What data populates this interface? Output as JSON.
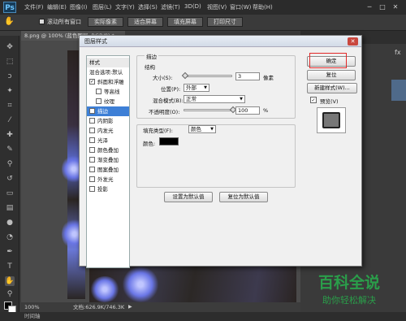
{
  "app": {
    "logo": "Ps"
  },
  "menu": [
    "文件(F)",
    "编辑(E)",
    "图像(I)",
    "图层(L)",
    "文字(Y)",
    "选择(S)",
    "滤镜(T)",
    "3D(D)",
    "视图(V)",
    "窗口(W)",
    "帮助(H)"
  ],
  "window_controls": {
    "minimize": "─",
    "restore": "□",
    "close": "✕"
  },
  "options_bar": {
    "scroll_all": "滚动所有窗口",
    "actual_pixels": "实际像素",
    "fit_screen": "适合屏幕",
    "fill_screen": "填充屏幕",
    "print_size": "打印尺寸"
  },
  "document": {
    "tab": "8.png @ 100% (蓝色图层, RGB/8) *",
    "zoom": "100%",
    "doc_info": "文档:626.9K/746.3K",
    "timeline": "时间轴"
  },
  "dialog": {
    "title": "图层样式",
    "close": "✕",
    "styles_header": "样式",
    "styles": [
      {
        "label": "混合选项:默认",
        "checkbox": false,
        "checked": false,
        "indent": false,
        "selected": false
      },
      {
        "label": "斜面和浮雕",
        "checkbox": true,
        "checked": true,
        "indent": false,
        "selected": false
      },
      {
        "label": "等高线",
        "checkbox": true,
        "checked": false,
        "indent": true,
        "selected": false
      },
      {
        "label": "纹理",
        "checkbox": true,
        "checked": false,
        "indent": true,
        "selected": false
      },
      {
        "label": "描边",
        "checkbox": true,
        "checked": true,
        "indent": false,
        "selected": true
      },
      {
        "label": "内阴影",
        "checkbox": true,
        "checked": false,
        "indent": false,
        "selected": false
      },
      {
        "label": "内发光",
        "checkbox": true,
        "checked": false,
        "indent": false,
        "selected": false
      },
      {
        "label": "光泽",
        "checkbox": true,
        "checked": false,
        "indent": false,
        "selected": false
      },
      {
        "label": "颜色叠加",
        "checkbox": true,
        "checked": false,
        "indent": false,
        "selected": false
      },
      {
        "label": "渐变叠加",
        "checkbox": true,
        "checked": false,
        "indent": false,
        "selected": false
      },
      {
        "label": "图案叠加",
        "checkbox": true,
        "checked": false,
        "indent": false,
        "selected": false
      },
      {
        "label": "外发光",
        "checkbox": true,
        "checked": false,
        "indent": false,
        "selected": false
      },
      {
        "label": "投影",
        "checkbox": true,
        "checked": false,
        "indent": false,
        "selected": false
      }
    ],
    "section_title": "描边",
    "structure_title": "结构",
    "size_label": "大小(S):",
    "size_value": "3",
    "size_unit": "像素",
    "size_fraction": 0.02,
    "position_label": "位置(P):",
    "position_value": "外部",
    "blend_label": "混合模式(B):",
    "blend_value": "正常",
    "opacity_label": "不透明度(O):",
    "opacity_value": "100",
    "opacity_unit": "%",
    "opacity_fraction": 1.0,
    "fill_type_label": "填充类型(F):",
    "fill_type_value": "颜色",
    "color_label": "颜色:",
    "color_swatch": "#000000",
    "set_default": "设置为默认值",
    "reset_default": "复位为默认值",
    "ok": "确定",
    "reset": "复位",
    "new_style": "新建样式(W)...",
    "preview_label": "预览(V)",
    "preview_checked": true
  },
  "watermark": {
    "line1": "百科全说",
    "line2": "助你轻松解决"
  },
  "colors": {
    "ok_highlight": "#e12828",
    "selected_style": "#3d7fd6",
    "watermark": "#2a9e4a"
  }
}
